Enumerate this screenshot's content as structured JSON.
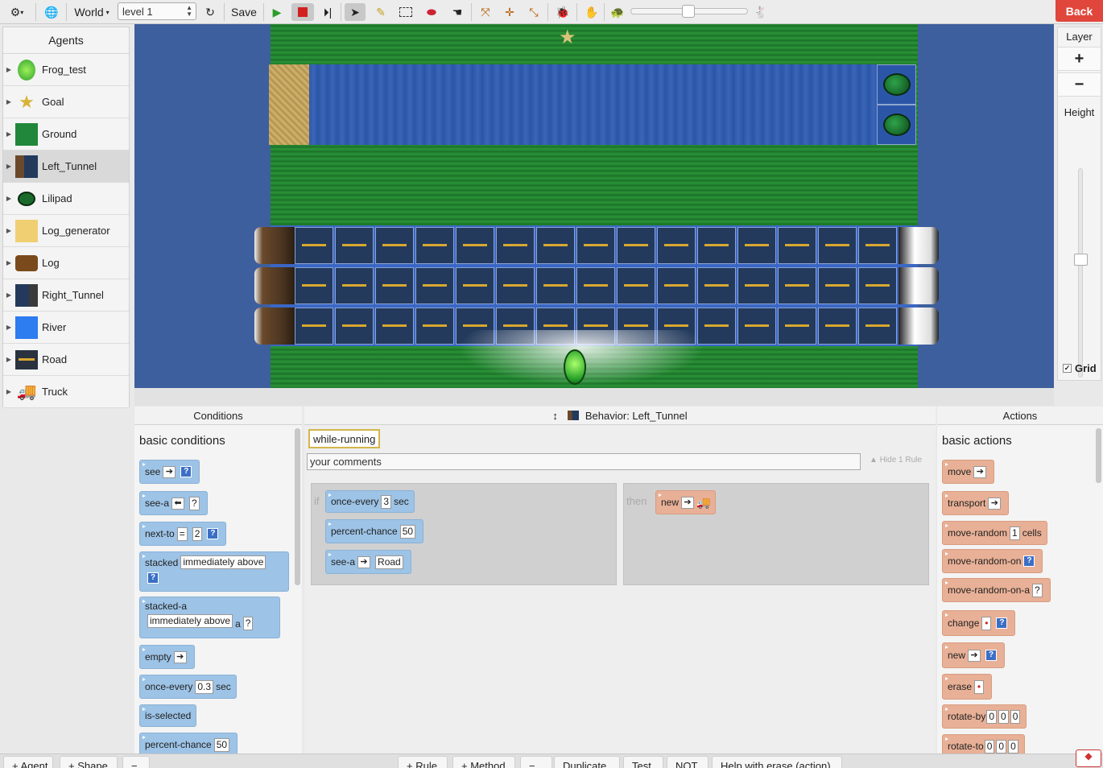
{
  "toolbar": {
    "world_label": "World",
    "level_value": "level 1",
    "save_label": "Save",
    "back_label": "Back"
  },
  "agents": {
    "title": "Agents",
    "items": [
      {
        "label": "Frog_test",
        "icon": "frog-icon"
      },
      {
        "label": "Goal",
        "icon": "star-icon"
      },
      {
        "label": "Ground",
        "icon": "grass-icon"
      },
      {
        "label": "Left_Tunnel",
        "icon": "left-tunnel-icon"
      },
      {
        "label": "Lilipad",
        "icon": "lilypad-icon"
      },
      {
        "label": "Log_generator",
        "icon": "sand-icon"
      },
      {
        "label": "Log",
        "icon": "log-icon"
      },
      {
        "label": "Right_Tunnel",
        "icon": "right-tunnel-icon"
      },
      {
        "label": "River",
        "icon": "water-icon"
      },
      {
        "label": "Road",
        "icon": "road-icon"
      },
      {
        "label": "Truck",
        "icon": "truck-icon"
      }
    ]
  },
  "layer": {
    "title": "Layer",
    "plus": "+",
    "minus": "−",
    "height_label": "Height",
    "grid_label": "Grid"
  },
  "conditions": {
    "header": "Conditions",
    "section": "basic conditions",
    "see": "see",
    "see_a": "see-a",
    "next_to": "next-to",
    "next_to_op": "=",
    "next_to_n": "2",
    "stacked": "stacked",
    "stacked_val": "immediately above",
    "stacked_a": "stacked-a",
    "stacked_a_val": "immediately above",
    "stacked_a_a": "a",
    "empty": "empty",
    "once_every": "once-every",
    "once_every_val": "0.3",
    "sec": "sec",
    "is_selected": "is-selected",
    "percent_chance": "percent-chance",
    "percent_val": "50"
  },
  "behavior": {
    "header": "Behavior: Left_Tunnel",
    "method": "while-running",
    "comment_placeholder": "your comments",
    "hide_rule": "Hide 1 Rule",
    "if_label": "if",
    "then_label": "then",
    "cond1": "once-every",
    "cond1_val": "3",
    "cond1_unit": "sec",
    "cond2": "percent-chance",
    "cond2_val": "50",
    "cond3": "see-a",
    "cond3_val": "Road",
    "action1": "new"
  },
  "actions": {
    "header": "Actions",
    "section": "basic actions",
    "move": "move",
    "transport": "transport",
    "move_random": "move-random",
    "move_random_val": "1",
    "cells": "cells",
    "move_random_on": "move-random-on",
    "move_random_on_a": "move-random-on-a",
    "change": "change",
    "new": "new",
    "erase": "erase",
    "rotate_by": "rotate-by",
    "rotate_to": "rotate-to",
    "zero": "0"
  },
  "bottom": {
    "agent": "+ Agent",
    "shape": "+ Shape",
    "minus": "−",
    "rule": "+ Rule",
    "method": "+ Method",
    "minus2": "−",
    "duplicate": "Duplicate",
    "test": "Test",
    "not": "NOT",
    "help": "Help with erase (action)"
  }
}
